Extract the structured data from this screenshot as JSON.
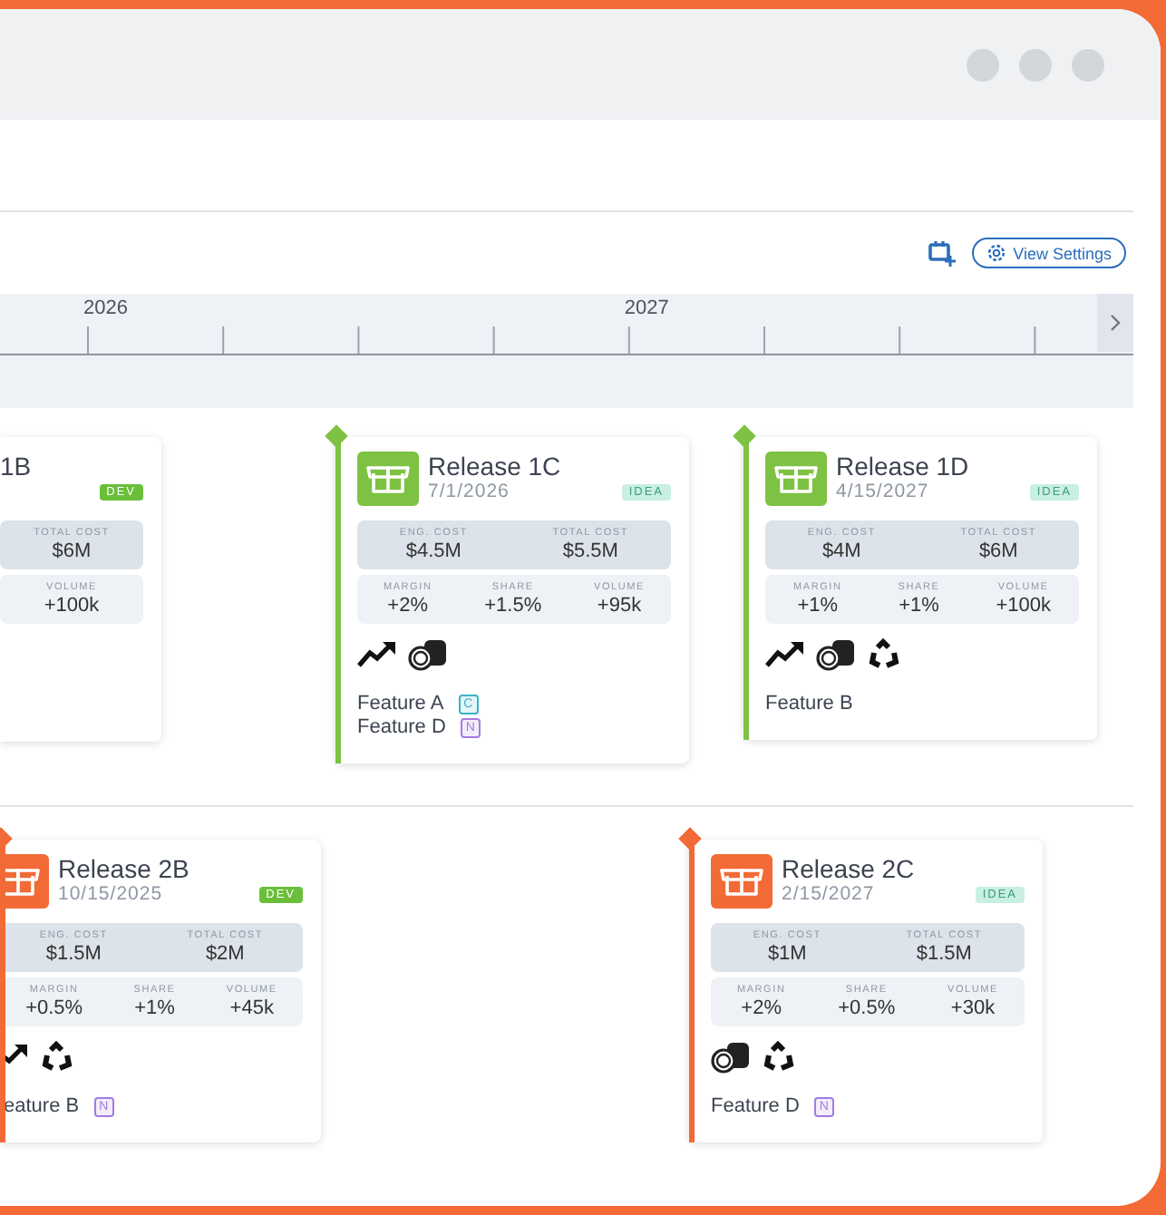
{
  "toolbar": {
    "view_settings": "View Settings"
  },
  "timeline": {
    "years": [
      {
        "label": "2026"
      },
      {
        "label": "2027"
      }
    ]
  },
  "lanes": [
    {
      "cards": [
        {
          "title": "1B",
          "clipped": true,
          "badge": {
            "text": "DEV",
            "kind": "dev"
          },
          "costs": [
            {
              "label": "TOTAL COST",
              "value": "$6M"
            }
          ],
          "metrics": [
            {
              "label": "VOLUME",
              "value": "+100k"
            }
          ]
        },
        {
          "title": "Release 1C",
          "date": "7/1/2026",
          "color": "#7dc242",
          "clipped": false,
          "badge": {
            "text": "IDEA",
            "kind": "idea"
          },
          "costs": [
            {
              "label": "ENG. COST",
              "value": "$4.5M"
            },
            {
              "label": "TOTAL COST",
              "value": "$5.5M"
            }
          ],
          "metrics": [
            {
              "label": "MARGIN",
              "value": "+2%"
            },
            {
              "label": "SHARE",
              "value": "+1.5%"
            },
            {
              "label": "VOLUME",
              "value": "+95k"
            }
          ],
          "drivers": [
            {
              "kind": "trend"
            },
            {
              "kind": "coins"
            }
          ],
          "features": [
            {
              "name": "Feature A",
              "tag": {
                "text": "C",
                "color": "#3bb3c3"
              }
            },
            {
              "name": "Feature D",
              "tag": {
                "text": "N",
                "color": "#a27be0"
              }
            }
          ]
        },
        {
          "title": "Release 1D",
          "date": "4/15/2027",
          "color": "#7dc242",
          "clipped": false,
          "badge": {
            "text": "IDEA",
            "kind": "idea"
          },
          "costs": [
            {
              "label": "ENG. COST",
              "value": "$4M"
            },
            {
              "label": "TOTAL COST",
              "value": "$6M"
            }
          ],
          "metrics": [
            {
              "label": "MARGIN",
              "value": "+1%"
            },
            {
              "label": "SHARE",
              "value": "+1%"
            },
            {
              "label": "VOLUME",
              "value": "+100k"
            }
          ],
          "drivers": [
            {
              "kind": "trend"
            },
            {
              "kind": "coins"
            },
            {
              "kind": "recycle"
            }
          ],
          "features": [
            {
              "name": "Feature B"
            }
          ]
        }
      ]
    },
    {
      "cards": [
        {
          "title": "Release 2B",
          "date": "10/15/2025",
          "color": "#f26a35",
          "clipped": true,
          "badge": {
            "text": "DEV",
            "kind": "dev"
          },
          "costs": [
            {
              "label": "ENG. COST",
              "value": "$1.5M"
            },
            {
              "label": "TOTAL COST",
              "value": "$2M"
            }
          ],
          "metrics": [
            {
              "label": "MARGIN",
              "value": "+0.5%"
            },
            {
              "label": "SHARE",
              "value": "+1%"
            },
            {
              "label": "VOLUME",
              "value": "+45k"
            }
          ],
          "drivers": [
            {
              "kind": "trend"
            },
            {
              "kind": "recycle"
            }
          ],
          "features": [
            {
              "name": "eature B",
              "tag": {
                "text": "N",
                "color": "#a27be0"
              }
            }
          ]
        },
        {
          "title": "Release 2C",
          "date": "2/15/2027",
          "color": "#f26a35",
          "clipped": false,
          "badge": {
            "text": "IDEA",
            "kind": "idea"
          },
          "costs": [
            {
              "label": "ENG. COST",
              "value": "$1M"
            },
            {
              "label": "TOTAL COST",
              "value": "$1.5M"
            }
          ],
          "metrics": [
            {
              "label": "MARGIN",
              "value": "+2%"
            },
            {
              "label": "SHARE",
              "value": "+0.5%"
            },
            {
              "label": "VOLUME",
              "value": "+30k"
            }
          ],
          "drivers": [
            {
              "kind": "coins"
            },
            {
              "kind": "recycle"
            }
          ],
          "features": [
            {
              "name": "Feature D",
              "tag": {
                "text": "N",
                "color": "#a27be0"
              }
            }
          ]
        }
      ]
    }
  ]
}
